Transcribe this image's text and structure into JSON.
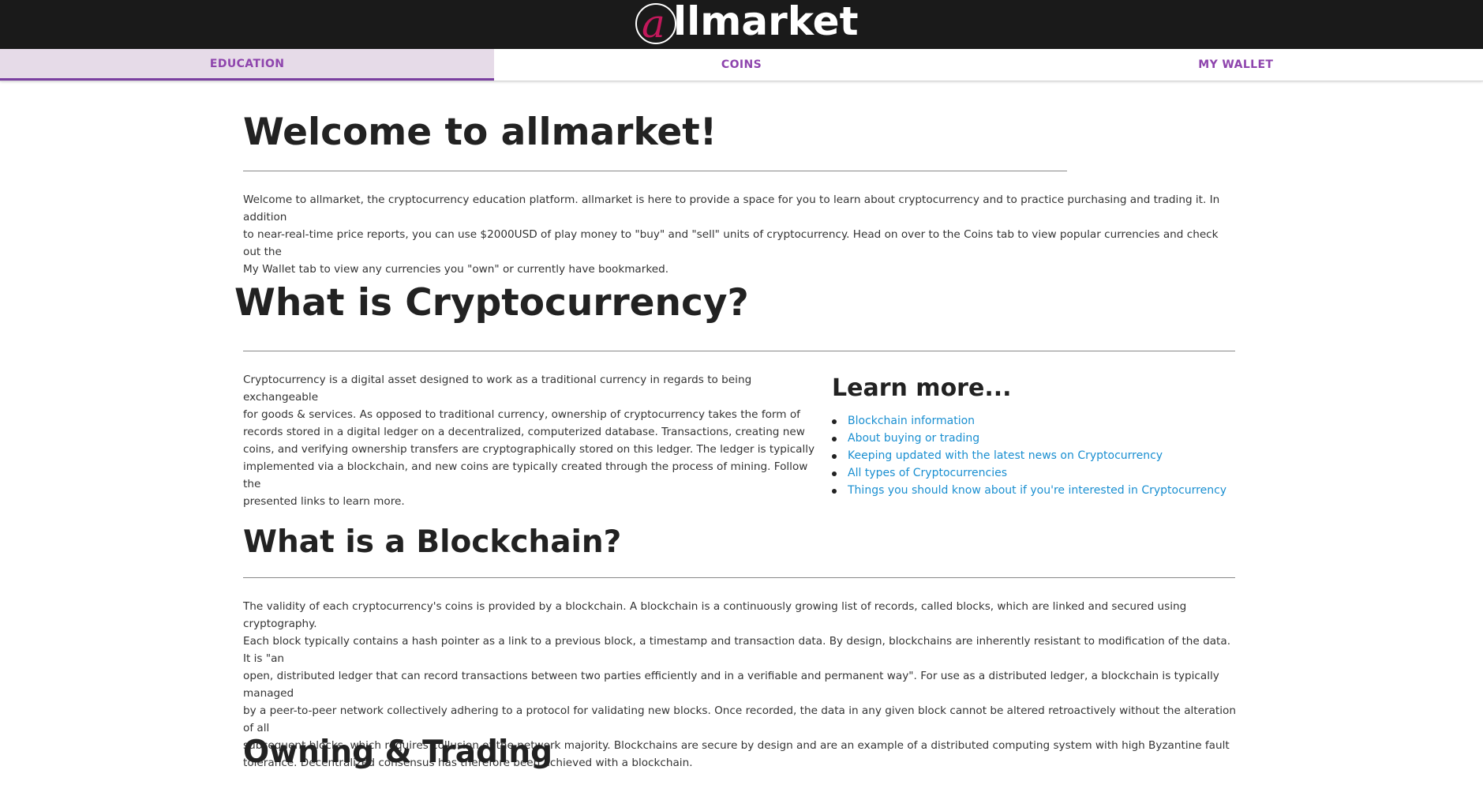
{
  "header": {
    "logo_letter": "a",
    "logo_rest": "llmarket",
    "logo_wordmark": "allmarket"
  },
  "tabs": [
    {
      "label": "EDUCATION",
      "active": true
    },
    {
      "label": "COINS",
      "active": false
    },
    {
      "label": "MY WALLET",
      "active": false
    }
  ],
  "welcome": {
    "title": "Welcome to allmarket!",
    "lines": [
      "Welcome to allmarket, the cryptocurrency education platform. allmarket is here to provide a space for you to learn about cryptocurrency and to practice purchasing and trading it. In addition",
      "to near-real-time price reports, you can use $2000USD of play money to \"buy\" and \"sell\" units of cryptocurrency. Head on over to the Coins tab to view popular currencies and check out the",
      "My Wallet tab to view any currencies you \"own\" or currently have bookmarked."
    ]
  },
  "crypto": {
    "title": "What is Cryptocurrency?",
    "lines": [
      "Cryptocurrency is a digital asset designed to work as a traditional currency in regards to being exchangeable",
      "for goods & services. As opposed to traditional currency, ownership of cryptocurrency takes the form of",
      "records stored in a digital ledger on a decentralized, computerized database. Transactions, creating new",
      "coins, and verifying ownership transfers are cryptographically stored on this ledger. The ledger is typically",
      "implemented via a blockchain, and new coins are typically created through the process of mining. Follow the",
      "presented links to learn more."
    ]
  },
  "learn_more": {
    "title": "Learn more...",
    "links": [
      "Blockchain information",
      "About buying or trading",
      "Keeping updated with the latest news on Cryptocurrency",
      "All types of Cryptocurrencies",
      "Things you should know about if you're interested in Cryptocurrency"
    ]
  },
  "blockchain": {
    "title": "What is a Blockchain?",
    "lines": [
      "The validity of each cryptocurrency's coins is provided by a blockchain. A blockchain is a continuously growing list of records, called blocks, which are linked and secured using cryptography.",
      "Each block typically contains a hash pointer as a link to a previous block, a timestamp and transaction data. By design, blockchains are inherently resistant to modification of the data. It is \"an",
      "open, distributed ledger that can record transactions between two parties efficiently and in a verifiable and permanent way\". For use as a distributed ledger, a blockchain is typically managed",
      "by a peer-to-peer network collectively adhering to a protocol for validating new blocks. Once recorded, the data in any given block cannot be altered retroactively without the alteration of all",
      "subsequent blocks, which requires collusion of the network majority. Blockchains are secure by design and are an example of a distributed computing system with high Byzantine fault",
      "tolerance. Decentralized consensus has therefore been achieved with a blockchain."
    ]
  },
  "owning": {
    "title": "Owning & Trading"
  }
}
